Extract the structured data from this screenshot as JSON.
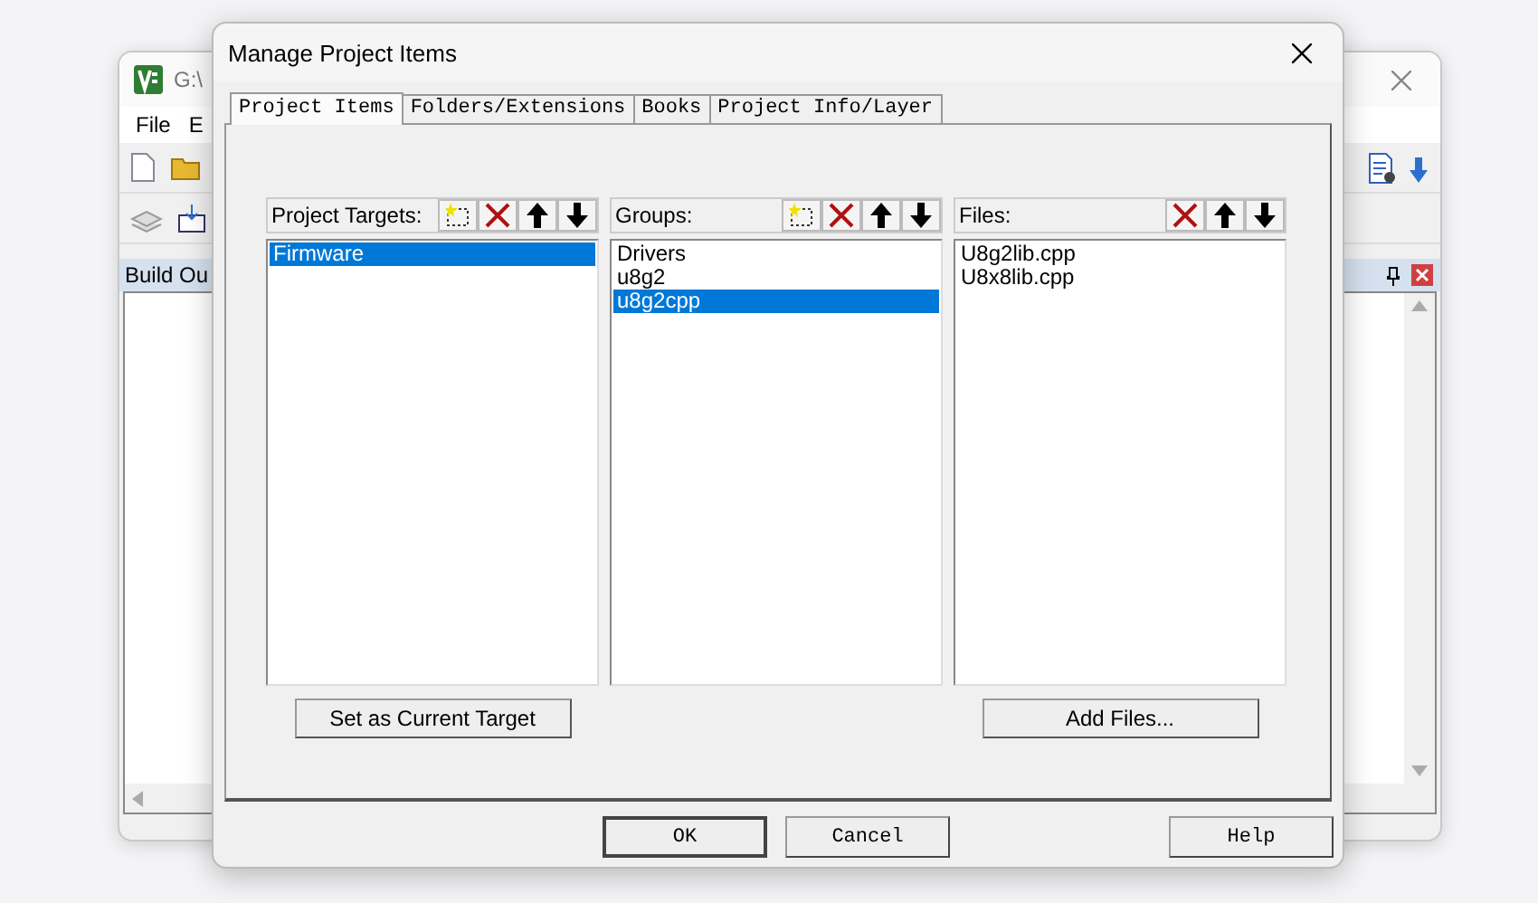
{
  "background_window": {
    "title": "G:\\",
    "menu": [
      "File",
      "E"
    ],
    "panel_title": "Build Ou"
  },
  "dialog": {
    "title": "Manage Project Items",
    "tabs": [
      {
        "label": "Project Items",
        "selected": true
      },
      {
        "label": "Folders/Extensions",
        "selected": false
      },
      {
        "label": "Books",
        "selected": false
      },
      {
        "label": "Project Info/Layer",
        "selected": false
      }
    ],
    "panels": [
      {
        "label": "Project Targets:",
        "tools": [
          {
            "kind": "new"
          },
          {
            "kind": "delete"
          },
          {
            "kind": "up"
          },
          {
            "kind": "down"
          }
        ],
        "items": [
          {
            "label": "Firmware",
            "selected": true
          }
        ],
        "button": "Set as Current Target"
      },
      {
        "label": "Groups:",
        "tools": [
          {
            "kind": "new"
          },
          {
            "kind": "delete"
          },
          {
            "kind": "up"
          },
          {
            "kind": "down"
          }
        ],
        "items": [
          {
            "label": "Drivers",
            "selected": false
          },
          {
            "label": "u8g2",
            "selected": false
          },
          {
            "label": "u8g2cpp",
            "selected": true
          }
        ]
      },
      {
        "label": "Files:",
        "tools": [
          {
            "kind": "delete"
          },
          {
            "kind": "up"
          },
          {
            "kind": "down"
          }
        ],
        "items": [
          {
            "label": "U8g2lib.cpp",
            "selected": false
          },
          {
            "label": "U8x8lib.cpp",
            "selected": false
          }
        ],
        "button": "Add Files..."
      }
    ],
    "footer_buttons": [
      {
        "label": "OK",
        "kind": "ok"
      },
      {
        "label": "Cancel",
        "kind": "cancel"
      },
      {
        "label": "Help",
        "kind": "help"
      }
    ]
  }
}
